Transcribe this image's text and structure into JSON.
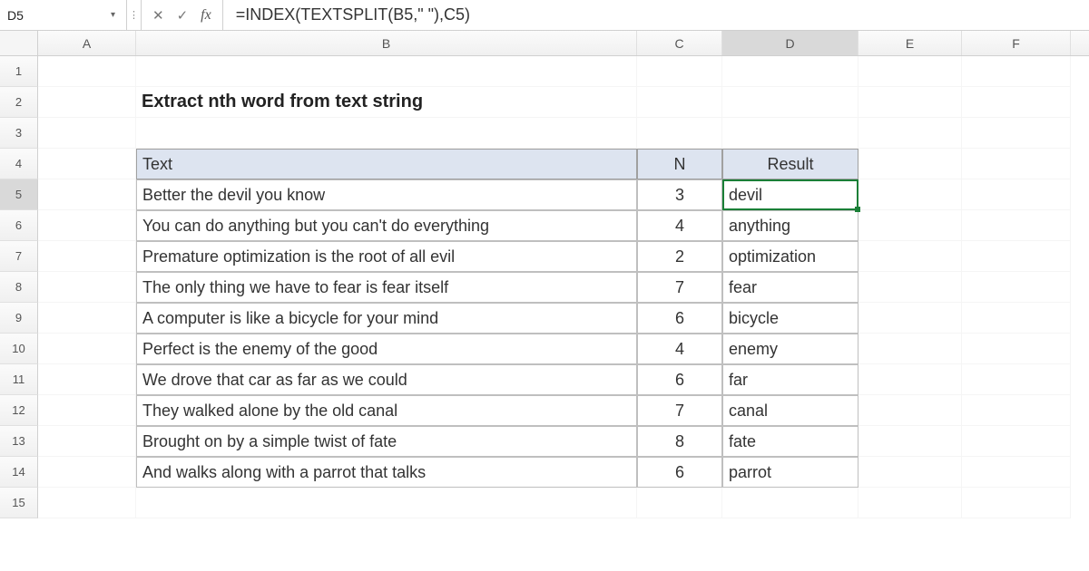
{
  "nameBox": "D5",
  "formula": "=INDEX(TEXTSPLIT(B5,\" \"),C5)",
  "columns": {
    "A": "A",
    "B": "B",
    "C": "C",
    "D": "D",
    "E": "E",
    "F": "F"
  },
  "rowNums": [
    "1",
    "2",
    "3",
    "4",
    "5",
    "6",
    "7",
    "8",
    "9",
    "10",
    "11",
    "12",
    "13",
    "14",
    "15"
  ],
  "title": "Extract nth word from text string",
  "headers": {
    "text": "Text",
    "n": "N",
    "result": "Result"
  },
  "rows": [
    {
      "text": "Better the devil you know",
      "n": "3",
      "result": "devil"
    },
    {
      "text": "You can do anything but you can't do everything",
      "n": "4",
      "result": "anything"
    },
    {
      "text": "Premature optimization is the root of all evil",
      "n": "2",
      "result": "optimization"
    },
    {
      "text": "The only thing we have to fear is fear itself",
      "n": "7",
      "result": "fear"
    },
    {
      "text": "A computer is like a bicycle for your mind",
      "n": "6",
      "result": "bicycle"
    },
    {
      "text": "Perfect is the enemy of the good",
      "n": "4",
      "result": "enemy"
    },
    {
      "text": "We drove that car as far as we could",
      "n": "6",
      "result": "far"
    },
    {
      "text": "They walked alone by the old canal",
      "n": "7",
      "result": "canal"
    },
    {
      "text": "Brought on by a simple twist of fate",
      "n": "8",
      "result": "fate"
    },
    {
      "text": "And walks along with a parrot that talks",
      "n": "6",
      "result": "parrot"
    }
  ],
  "icons": {
    "cancel": "✕",
    "confirm": "✓",
    "fx": "fx",
    "sepDots": "⋮"
  }
}
